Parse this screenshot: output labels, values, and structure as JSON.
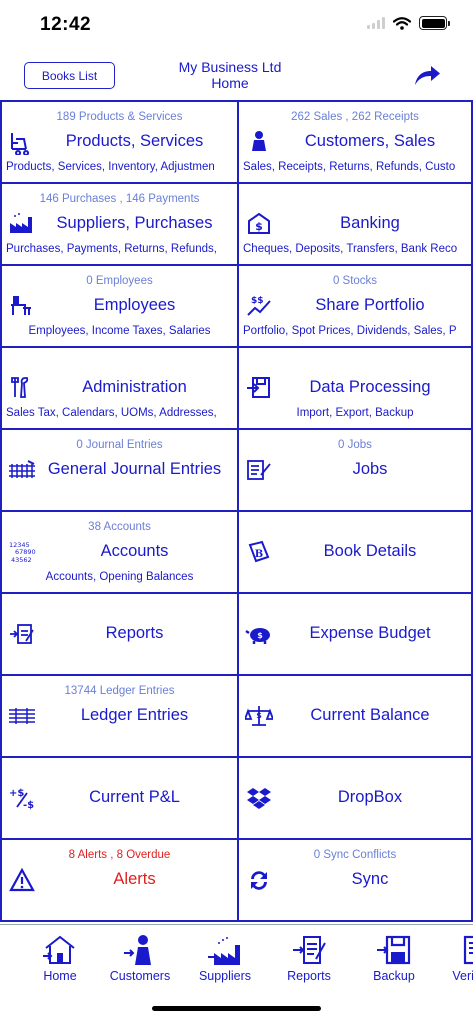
{
  "status": {
    "time": "12:42"
  },
  "nav": {
    "books_list_label": "Books List",
    "title_line1": "My Business Ltd",
    "title_line2": "Home"
  },
  "grid": [
    {
      "count": "189 Products & Services",
      "title": "Products, Services",
      "subtitle": "Products, Services, Inventory, Adjustmen",
      "icon": "forklift-icon"
    },
    {
      "count": "262 Sales , 262 Receipts",
      "title": "Customers, Sales",
      "subtitle": "Sales, Receipts, Returns, Refunds, Custo",
      "icon": "customer-icon"
    },
    {
      "count": "146 Purchases , 146 Payments",
      "title": "Suppliers, Purchases",
      "subtitle": "Purchases, Payments, Returns, Refunds,",
      "icon": "factory-icon"
    },
    {
      "count": "",
      "title": "Banking",
      "subtitle": "Cheques, Deposits, Transfers, Bank Reco",
      "icon": "bank-icon"
    },
    {
      "count": "0 Employees",
      "title": "Employees",
      "subtitle": "Employees, Income Taxes, Salaries",
      "icon": "employee-desk-icon"
    },
    {
      "count": "0 Stocks",
      "title": "Share Portfolio",
      "subtitle": "Portfolio, Spot Prices, Dividends, Sales, P",
      "icon": "stock-chart-icon"
    },
    {
      "count": "",
      "title": "Administration",
      "subtitle": "Sales Tax, Calendars, UOMs, Addresses,",
      "icon": "tools-icon"
    },
    {
      "count": "",
      "title": "Data Processing",
      "subtitle": "Import, Export, Backup",
      "icon": "disk-import-icon"
    },
    {
      "count": "0 Journal Entries",
      "title": "General Journal Entries",
      "subtitle": "",
      "icon": "journal-icon"
    },
    {
      "count": "0 Jobs",
      "title": "Jobs",
      "subtitle": "",
      "icon": "job-list-icon"
    },
    {
      "count": "38 Accounts",
      "title": "Accounts",
      "subtitle": "Accounts, Opening Balances",
      "icon": "account-numbers-icon"
    },
    {
      "count": "",
      "title": "Book Details",
      "subtitle": "",
      "icon": "book-badge-icon"
    },
    {
      "count": "",
      "title": "Reports",
      "subtitle": "",
      "icon": "report-icon"
    },
    {
      "count": "",
      "title": "Expense Budget",
      "subtitle": "",
      "icon": "piggy-bank-icon"
    },
    {
      "count": "13744 Ledger Entries",
      "title": "Ledger Entries",
      "subtitle": "",
      "icon": "ledger-icon"
    },
    {
      "count": "",
      "title": "Current Balance",
      "subtitle": "",
      "icon": "balance-scale-icon"
    },
    {
      "count": "",
      "title": "Current P&L",
      "subtitle": "",
      "icon": "profit-loss-icon"
    },
    {
      "count": "",
      "title": "DropBox",
      "subtitle": "",
      "icon": "dropbox-icon"
    },
    {
      "count": "8 Alerts , 8 Overdue",
      "title": "Alerts",
      "subtitle": "",
      "icon": "alert-triangle-icon",
      "alert": true
    },
    {
      "count": "0 Sync Conflicts",
      "title": "Sync",
      "subtitle": "",
      "icon": "sync-icon"
    }
  ],
  "tabs": [
    {
      "label": "Home",
      "icon": "home-icon"
    },
    {
      "label": "Customers",
      "icon": "customer-tab-icon"
    },
    {
      "label": "Suppliers",
      "icon": "supplier-tab-icon"
    },
    {
      "label": "Reports",
      "icon": "reports-tab-icon"
    },
    {
      "label": "Backup",
      "icon": "backup-tab-icon"
    },
    {
      "label": "Verify",
      "icon": "verify-tab-icon"
    }
  ],
  "colors": {
    "accent": "#1a1acc",
    "border": "#1f1fc2",
    "count": "#6a7fd8",
    "alert": "#e02020"
  }
}
